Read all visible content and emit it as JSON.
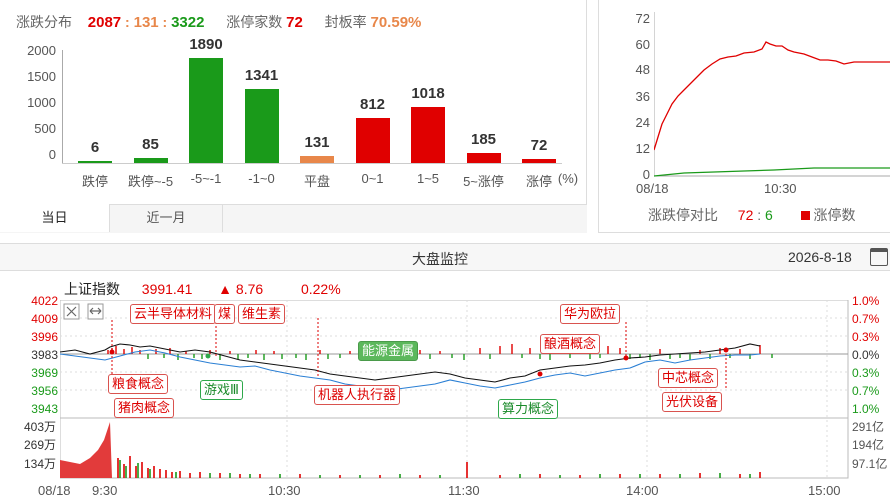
{
  "distribution": {
    "title": "涨跌分布",
    "up": "2087",
    "sep1": ":",
    "flat": "131",
    "sep2": ":",
    "down": "3322",
    "limit_up_label": "涨停家数",
    "limit_up_value": "72",
    "seal_rate_label": "封板率",
    "seal_rate_value": "70.59%",
    "y_ticks": [
      "2000",
      "1500",
      "1000",
      "500",
      "0"
    ],
    "unit": "(%)",
    "tabs": [
      "当日",
      "近一月"
    ]
  },
  "chart_data": [
    {
      "type": "bar",
      "categories": [
        "跌停",
        "跌停~-5",
        "-5~-1",
        "-1~0",
        "平盘",
        "0~1",
        "1~5",
        "5~涨停",
        "涨停"
      ],
      "values": [
        6,
        85,
        1890,
        1341,
        131,
        812,
        1018,
        185,
        72
      ],
      "colors": [
        "#1a9a1a",
        "#1a9a1a",
        "#1a9a1a",
        "#1a9a1a",
        "#e8874a",
        "#e00000",
        "#e00000",
        "#e00000",
        "#e00000"
      ],
      "ylim": [
        0,
        2000
      ],
      "xlabel": "",
      "ylabel": ""
    }
  ],
  "limit_panel": {
    "y_ticks": [
      "72",
      "60",
      "48",
      "36",
      "24",
      "12",
      "0"
    ],
    "x_ticks": [
      "08/18",
      "10:30"
    ],
    "label": "涨跌停对比",
    "up_value": "72",
    "sep": ":",
    "down_value": "6",
    "legend": "涨停数"
  },
  "monitor": {
    "title": "大盘监控",
    "date": "2026-8-18",
    "index_name": "上证指数",
    "index_value": "3991.41",
    "change_arrow": "▲",
    "change": "8.76",
    "change_pct": "0.22%",
    "price_ticks": [
      "4022",
      "4009",
      "3996",
      "3983",
      "3969",
      "3956",
      "3943"
    ],
    "pct_ticks": [
      "1.0%",
      "0.7%",
      "0.3%",
      "0.0%",
      "0.3%",
      "0.7%",
      "1.0%"
    ],
    "vol_ticks": [
      "403万",
      "269万",
      "134万"
    ],
    "amt_ticks": [
      "291亿",
      "194亿",
      "97.1亿"
    ],
    "time_ticks": [
      "08/18",
      "9:30",
      "10:30",
      "11:30",
      "14:00",
      "15:00"
    ],
    "tags": {
      "t1": "半导体材料",
      "t1_prefix": "云",
      "t2": "煤",
      "t3": "维生素",
      "t4": "能源金属",
      "t5": "粮食概念",
      "t6": "猪肉概念",
      "t7": "游戏Ⅲ",
      "t8": "机器人执行器",
      "t9": "算力概念",
      "t10": "华为欧拉",
      "t11": "酿酒概念",
      "t12": "中芯概念",
      "t13": "光伏设备"
    }
  }
}
